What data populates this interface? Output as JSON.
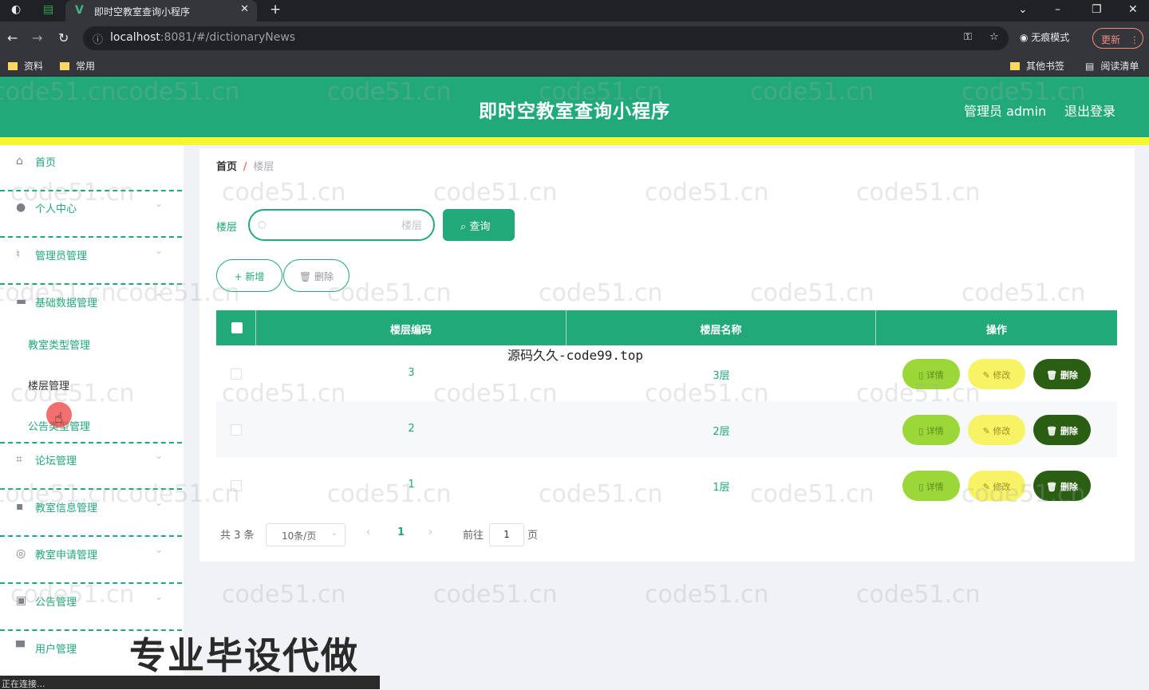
{
  "browser": {
    "tab_title": "即时空教室查询小程序",
    "tab_logo": "V",
    "url_host": "localhost",
    "url_path": ":8081/#/dictionaryNews",
    "incognito_label": "无痕模式",
    "update_label": "更新",
    "bookmarks": [
      "资料",
      "常用"
    ],
    "bookmarks_right": [
      "其他书签",
      "阅读清单"
    ]
  },
  "header": {
    "title": "即时空教室查询小程序",
    "admin_label": "管理员 admin",
    "logout_label": "退出登录"
  },
  "sidebar": {
    "items": [
      {
        "label": "首页",
        "icon": "home-icon"
      },
      {
        "label": "个人中心",
        "icon": "user-icon"
      },
      {
        "label": "管理员管理",
        "icon": "microphone-icon"
      },
      {
        "label": "基础数据管理",
        "icon": "briefcase-icon"
      },
      {
        "label": "论坛管理",
        "icon": "crop-icon"
      },
      {
        "label": "教室信息管理",
        "icon": "chat-icon"
      },
      {
        "label": "教室申请管理",
        "icon": "globe-icon"
      },
      {
        "label": "公告管理",
        "icon": "ticket-icon"
      },
      {
        "label": "用户管理",
        "icon": "printer-icon"
      }
    ],
    "submenu": [
      "教室类型管理",
      "楼层管理",
      "公告类型管理"
    ]
  },
  "breadcrumb": {
    "home": "首页",
    "separator": "/",
    "current": "楼层"
  },
  "search": {
    "label": "楼层",
    "placeholder": "楼层",
    "button_label": "查询"
  },
  "toolbar": {
    "add_label": "+ 新增",
    "delete_label": "删除"
  },
  "table": {
    "columns": [
      "楼层编码",
      "楼层名称",
      "操作"
    ],
    "rows": [
      {
        "code": "3",
        "name": "3层"
      },
      {
        "code": "2",
        "name": "2层"
      },
      {
        "code": "1",
        "name": "1层"
      }
    ],
    "actions": {
      "detail": "详情",
      "edit": "修改",
      "delete": "删除"
    }
  },
  "pagination": {
    "total_text": "共 3 条",
    "page_size": "10条/页",
    "current_page": "1",
    "goto_prefix": "前往",
    "goto_value": "1",
    "goto_suffix": "页"
  },
  "overlays": {
    "watermark_text": "code51.cn",
    "center_watermark": "源码久久-code99.top",
    "promo_text": "专业毕设代做",
    "status_text": "正在连接..."
  },
  "colors": {
    "primary": "#22a97a",
    "accent_yellow": "#f5f531",
    "detail": "#9cd73a",
    "edit": "#f7f364",
    "delete": "#2a5e12"
  }
}
